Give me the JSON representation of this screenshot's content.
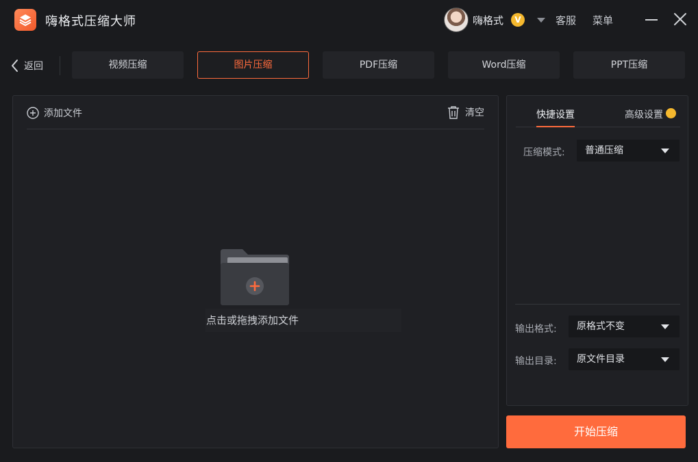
{
  "app": {
    "title": "嗨格式压缩大师"
  },
  "user": {
    "name": "嗨格式",
    "badge": "V"
  },
  "header": {
    "service_label": "客服",
    "menu_label": "菜单"
  },
  "nav": {
    "back_label": "返回",
    "tabs": [
      {
        "label": "视频压缩",
        "active": false
      },
      {
        "label": "图片压缩",
        "active": true
      },
      {
        "label": "PDF压缩",
        "active": false
      },
      {
        "label": "Word压缩",
        "active": false
      },
      {
        "label": "PPT压缩",
        "active": false
      }
    ]
  },
  "file_panel": {
    "add_file_label": "添加文件",
    "clear_label": "清空",
    "drop_hint": "点击或拖拽添加文件"
  },
  "settings": {
    "tabs": [
      {
        "label": "快捷设置",
        "active": true
      },
      {
        "label": "高级设置",
        "active": false
      }
    ],
    "compress_mode": {
      "label": "压缩模式:",
      "value": "普通压缩"
    },
    "output_format": {
      "label": "输出格式:",
      "value": "原格式不变"
    },
    "output_dir": {
      "label": "输出目录:",
      "value": "原文件目录"
    }
  },
  "actions": {
    "start_label": "开始压缩"
  },
  "colors": {
    "accent": "#ff6b3d",
    "background": "#1a1b1e",
    "panel": "#1f2024",
    "vip": "#f5b82e"
  }
}
